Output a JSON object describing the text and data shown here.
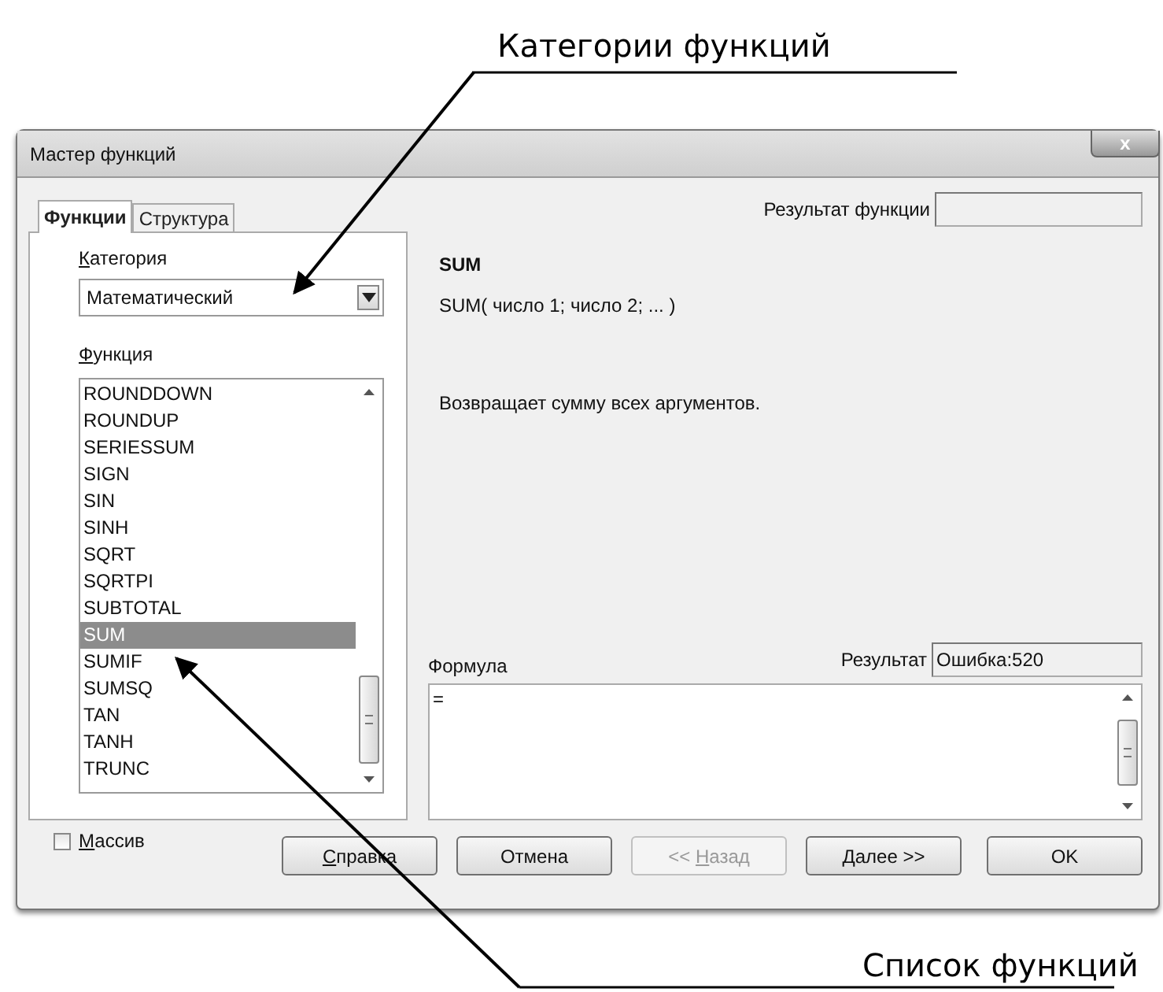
{
  "annotations": [
    {
      "text": "Категории функций"
    },
    {
      "text": "Список функций"
    }
  ],
  "window": {
    "title": "Мастер функций",
    "close": "x"
  },
  "tabs": [
    {
      "label": "Функции",
      "selected": true
    },
    {
      "label": "Структура",
      "selected": false
    }
  ],
  "category": {
    "label": {
      "key": "К",
      "after": "атегория"
    },
    "value": "Математический"
  },
  "function_list": {
    "label": {
      "key": "Ф",
      "after": "ункция"
    },
    "items": [
      {
        "name": "ROUNDDOWN",
        "selected": false
      },
      {
        "name": "ROUNDUP",
        "selected": false
      },
      {
        "name": "SERIESSUM",
        "selected": false
      },
      {
        "name": "SIGN",
        "selected": false
      },
      {
        "name": "SIN",
        "selected": false
      },
      {
        "name": "SINH",
        "selected": false
      },
      {
        "name": "SQRT",
        "selected": false
      },
      {
        "name": "SQRTPI",
        "selected": false
      },
      {
        "name": "SUBTOTAL",
        "selected": false
      },
      {
        "name": "SUM",
        "selected": true
      },
      {
        "name": "SUMIF",
        "selected": false
      },
      {
        "name": "SUMSQ",
        "selected": false
      },
      {
        "name": "TAN",
        "selected": false
      },
      {
        "name": "TANH",
        "selected": false
      },
      {
        "name": "TRUNC",
        "selected": false
      }
    ]
  },
  "function_result": {
    "label": "Результат функции"
  },
  "function_name": "SUM",
  "syntax": "SUM( число 1; число 2; ... )",
  "description": "Возвращает сумму всех аргументов.",
  "formula": {
    "label": "Формула",
    "value": "="
  },
  "result": {
    "label": "Результат",
    "value": "Ошибка:520"
  },
  "array_checkbox": {
    "label": {
      "key": "М",
      "after": "ассив"
    },
    "checked": false
  },
  "buttons": [
    {
      "key": "С",
      "after": "правка",
      "disabled": false
    },
    {
      "after": "Отмена",
      "disabled": false
    },
    {
      "before": "<< ",
      "key": "Н",
      "after": "азад",
      "disabled": true
    },
    {
      "key": "Д",
      "after": "алее >>",
      "disabled": false
    },
    {
      "after": "OK",
      "disabled": false
    }
  ]
}
